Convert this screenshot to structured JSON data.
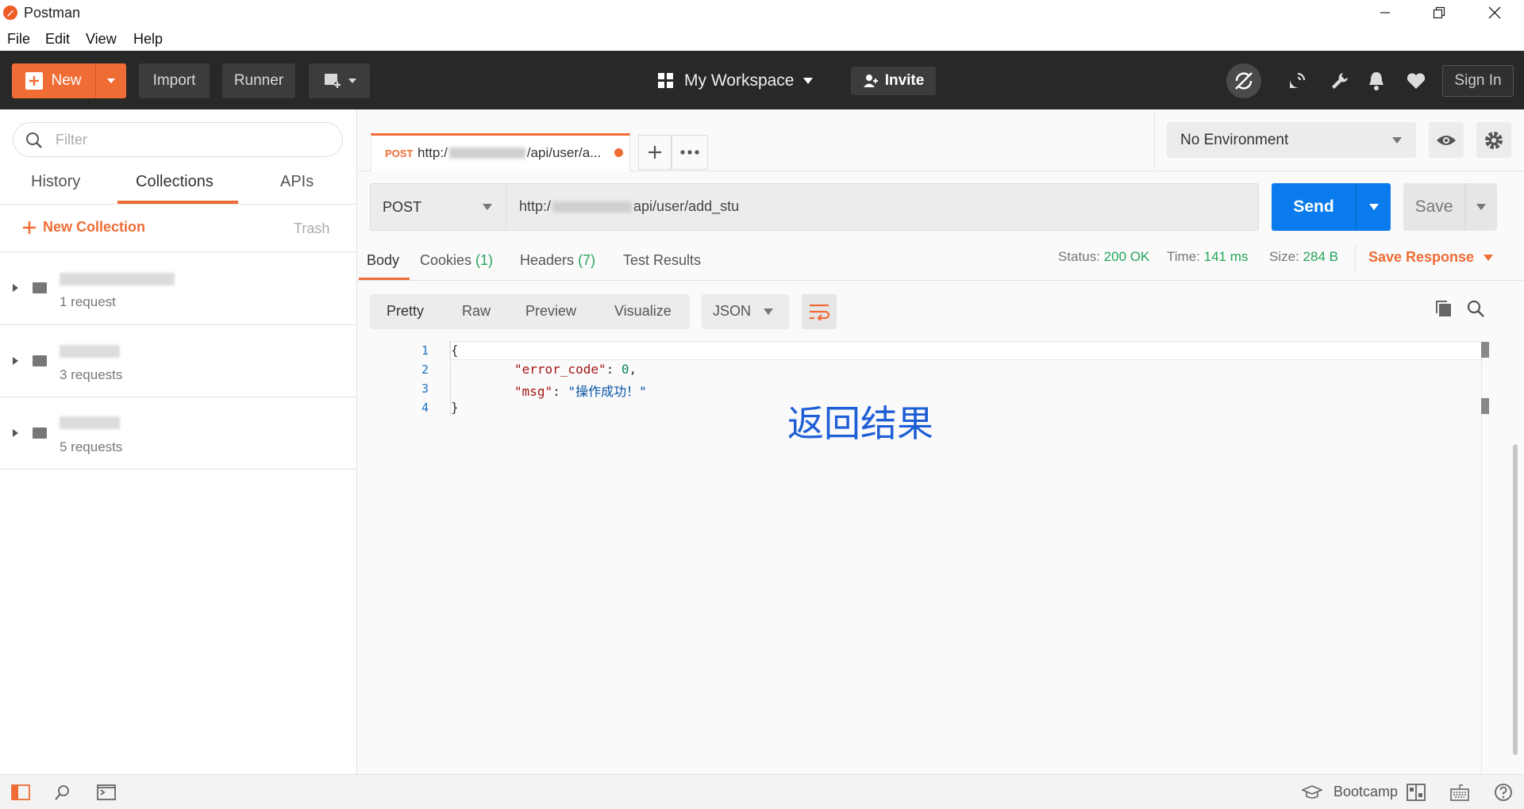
{
  "app": {
    "title": "Postman"
  },
  "menu": [
    "File",
    "Edit",
    "View",
    "Help"
  ],
  "toolbar": {
    "new_label": "New",
    "import_label": "Import",
    "runner_label": "Runner",
    "workspace_label": "My Workspace",
    "invite_label": "Invite",
    "signin_label": "Sign In"
  },
  "sidebar": {
    "filter_placeholder": "Filter",
    "tabs": [
      "History",
      "Collections",
      "APIs"
    ],
    "active_tab": "Collections",
    "new_collection_label": "New Collection",
    "trash_label": "Trash",
    "collections": [
      {
        "count_label": "1 request"
      },
      {
        "count_label": "3 requests"
      },
      {
        "count_label": "5 requests"
      }
    ]
  },
  "request_tab": {
    "method": "POST",
    "url_start": "http:/",
    "url_end": "/api/user/a..."
  },
  "environment": {
    "selected": "No Environment"
  },
  "request": {
    "method": "POST",
    "url_start": "http:/",
    "url_end": "api/user/add_stu",
    "send_label": "Send",
    "save_label": "Save"
  },
  "response": {
    "tabs": {
      "body": "Body",
      "cookies": "Cookies",
      "cookies_count": "(1)",
      "headers": "Headers",
      "headers_count": "(7)",
      "tests": "Test Results"
    },
    "status_label": "Status:",
    "status_value": "200 OK",
    "time_label": "Time:",
    "time_value": "141 ms",
    "size_label": "Size:",
    "size_value": "284 B",
    "save_response_label": "Save Response",
    "formats": [
      "Pretty",
      "Raw",
      "Preview",
      "Visualize"
    ],
    "language": "JSON",
    "code": {
      "line_numbers": [
        "1",
        "2",
        "3",
        "4"
      ],
      "open_brace": "{",
      "close_brace": "}",
      "error_code_key": "\"error_code\"",
      "error_code_value": "0",
      "msg_key": "\"msg\"",
      "msg_value": "\"操作成功！\""
    },
    "annotation": "返回结果"
  },
  "statusbar": {
    "bootcamp_label": "Bootcamp"
  },
  "colors": {
    "accent": "#ef6c35",
    "send_blue": "#097bed",
    "toolbar_bg": "#282828",
    "status_green": "#23a55a"
  }
}
